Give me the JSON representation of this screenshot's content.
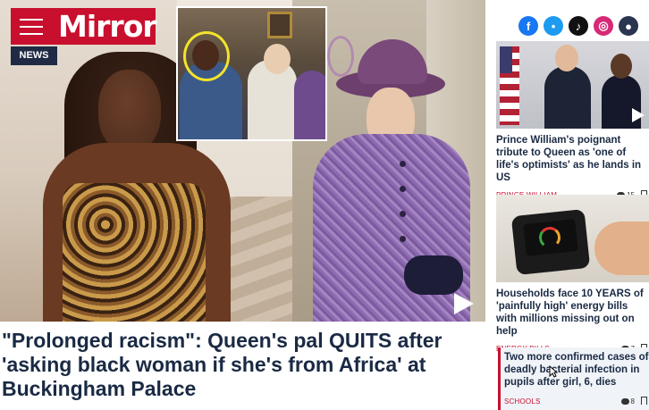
{
  "site": {
    "logo": "Mirror",
    "section_tag": "NEWS"
  },
  "hero": {
    "headline": "\"Prolonged racism\": Queen's pal QUITS after 'asking black woman if she's from Africa' at Buckingham Palace"
  },
  "social": [
    {
      "name": "facebook-icon",
      "glyph": "f"
    },
    {
      "name": "twitter-icon",
      "glyph": "•"
    },
    {
      "name": "tiktok-icon",
      "glyph": "♪"
    },
    {
      "name": "instagram-icon",
      "glyph": "◎"
    },
    {
      "name": "user-icon",
      "glyph": "●"
    }
  ],
  "sidebar": [
    {
      "title": "Prince William's poignant tribute to Queen as 'one of life's optimists' as he lands in US",
      "category": "PRINCE WILLIAM",
      "comments": "15"
    },
    {
      "title": "Households face 10 YEARS of 'painfully high' energy bills with millions missing out on help",
      "category": "ENERGY BILLS",
      "comments": "7"
    },
    {
      "title": "Two more confirmed cases of deadly bacterial infection in pupils after girl, 6, dies",
      "category": "SCHOOLS",
      "comments": "8"
    }
  ],
  "colors": {
    "brand": "#c8102e",
    "navy": "#1a2a44"
  }
}
